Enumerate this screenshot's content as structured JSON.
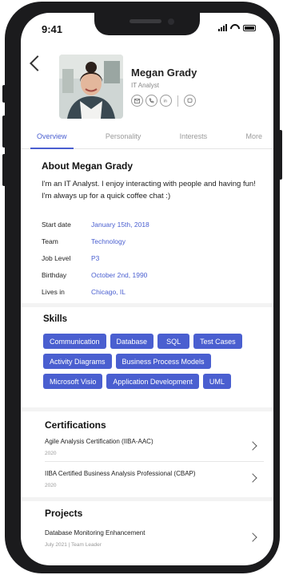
{
  "status": {
    "time": "9:41"
  },
  "profile": {
    "name": "Megan Grady",
    "role": "IT Analyst",
    "contact_icons": [
      "message-icon",
      "phone-icon",
      "linkedin-icon",
      "chat-icon"
    ]
  },
  "tabs": [
    {
      "label": "Overview",
      "active": true
    },
    {
      "label": "Personality",
      "active": false
    },
    {
      "label": "Interests",
      "active": false
    },
    {
      "label": "More",
      "active": false
    }
  ],
  "about": {
    "title": "About Megan Grady",
    "text": "I'm an IT Analyst. I enjoy interacting with people and having fun! I'm always up for a quick coffee chat :)",
    "fields": [
      {
        "key": "Start date",
        "value": "January 15th, 2018"
      },
      {
        "key": "Team",
        "value": "Technology"
      },
      {
        "key": "Job Level",
        "value": "P3"
      },
      {
        "key": "Birthday",
        "value": "October 2nd, 1990"
      },
      {
        "key": "Lives in",
        "value": "Chicago, IL"
      }
    ]
  },
  "skills": {
    "title": "Skills",
    "rows": [
      [
        "Communication",
        "Database",
        "SQL",
        "Test Cases"
      ],
      [
        "Activity Diagrams",
        "Business Process Models"
      ],
      [
        "Microsoft Visio",
        "Application Development",
        "UML"
      ]
    ]
  },
  "certifications": {
    "title": "Certifications",
    "items": [
      {
        "title": "Agile Analysis Certification (IIBA-AAC)",
        "sub": "2020"
      },
      {
        "title": "IIBA Certified Business Analysis Professional (CBAP)",
        "sub": "2020"
      }
    ]
  },
  "projects": {
    "title": "Projects",
    "items": [
      {
        "title": "Database Monitoring Enhancement",
        "sub": "July 2021 | Team Leader"
      }
    ]
  },
  "colors": {
    "accent": "#4a5fd0",
    "frame": "#1b1b1d"
  }
}
